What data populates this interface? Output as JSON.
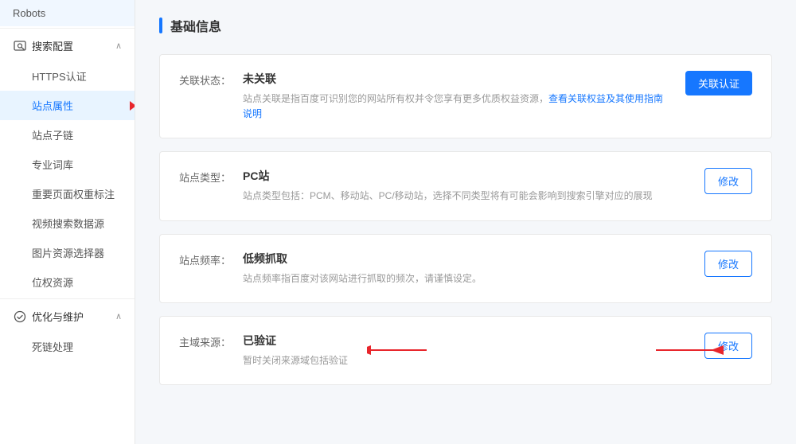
{
  "sidebar": {
    "standalone_item": "Robots",
    "section1": {
      "icon": "🔍",
      "label": "搜索配置",
      "items": [
        {
          "label": "HTTPS认证",
          "active": false
        },
        {
          "label": "站点属性",
          "active": true
        },
        {
          "label": "站点子链",
          "active": false
        },
        {
          "label": "专业词库",
          "active": false
        },
        {
          "label": "重要页面权重标注",
          "active": false
        },
        {
          "label": "视频搜索数据源",
          "active": false
        },
        {
          "label": "图片资源选择器",
          "active": false
        },
        {
          "label": "位权资源",
          "active": false
        }
      ]
    },
    "section2": {
      "icon": "⚙",
      "label": "优化与维护",
      "items": [
        {
          "label": "死链处理",
          "active": false
        }
      ]
    }
  },
  "main": {
    "section_title": "基础信息",
    "rows": [
      {
        "id": "row1",
        "label": "关联状态：",
        "content_title": "未关联",
        "content_desc": "站点关联是指百度可识别您的网站所有权并令您享有更多优质权益资源，查看关联权益及其使用指南说明",
        "content_link": "查看关联权益及其使用指南说明",
        "action_label": "关联认证",
        "action_type": "primary"
      },
      {
        "id": "row2",
        "label": "站点类型：",
        "content_title": "PC站",
        "content_desc": "站点类型包括：PCM、移动站、PC/移动站，选择不同类型将有可能会影响到搜索引擎对应的展现",
        "content_link": "",
        "action_label": "修改",
        "action_type": "outline"
      },
      {
        "id": "row3",
        "label": "站点频率：",
        "content_title": "低频抓取",
        "content_desc": "站点频率指百度对该网站进行抓取的频次，请谨慎设定。",
        "content_link": "",
        "action_label": "修改",
        "action_type": "outline"
      },
      {
        "id": "row4",
        "label": "主域来源：",
        "content_title": "已验证",
        "content_desc": "暂时关闭来源域包括验证",
        "content_link": "",
        "action_label": "修改",
        "action_type": "outline",
        "has_red_arrows": true
      }
    ]
  }
}
